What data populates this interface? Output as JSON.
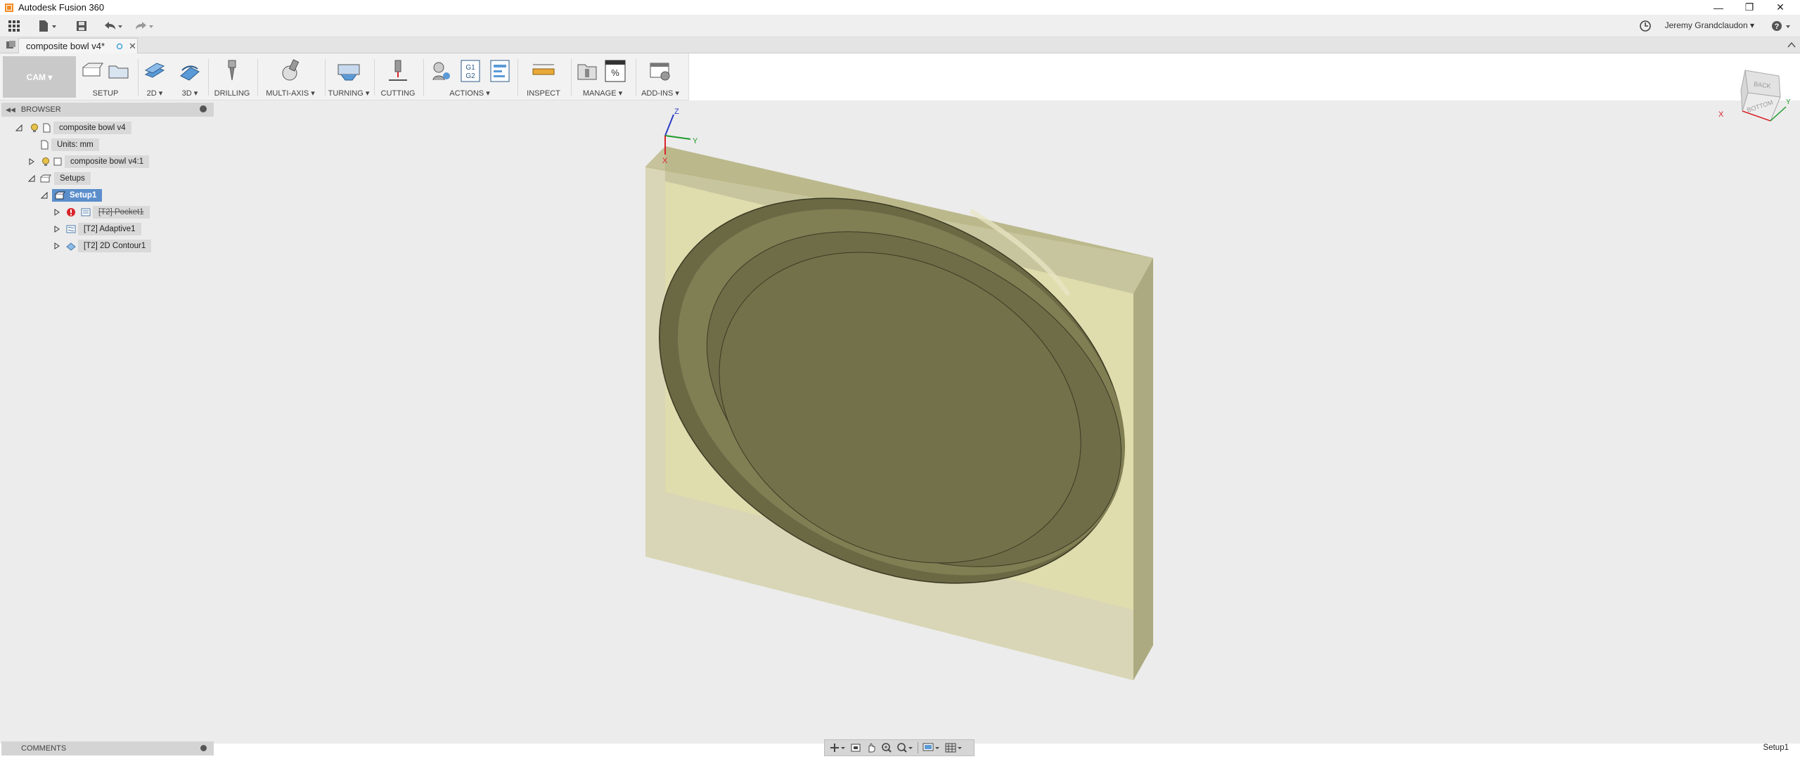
{
  "window": {
    "title": "Autodesk Fusion 360",
    "controls": [
      "minimize-icon",
      "restore-icon",
      "close-icon"
    ]
  },
  "quick_access": {
    "icons": [
      "apps-grid-icon",
      "file-icon",
      "save-icon",
      "undo-icon",
      "redo-icon"
    ],
    "job_status_icon": "clock-icon",
    "user_name": "Jeremy Grandclaudon",
    "help_icon": "help-icon"
  },
  "document_tab": {
    "name": "composite bowl v4*"
  },
  "toolbar": {
    "workspace": "CAM",
    "groups": [
      {
        "label": "SETUP"
      },
      {
        "label": "2D"
      },
      {
        "label": "3D"
      },
      {
        "label": "DRILLING"
      },
      {
        "label": "MULTI-AXIS"
      },
      {
        "label": "TURNING"
      },
      {
        "label": "CUTTING"
      },
      {
        "label": "ACTIONS"
      },
      {
        "label": "INSPECT"
      },
      {
        "label": "MANAGE"
      },
      {
        "label": "ADD-INS"
      }
    ]
  },
  "browser": {
    "title": "BROWSER",
    "tree": {
      "root": "composite bowl v4",
      "units": "Units: mm",
      "component": "composite bowl v4:1",
      "setups": "Setups",
      "setup1": "Setup1",
      "ops": [
        {
          "label": "[T2] Pocket1",
          "status": "error"
        },
        {
          "label": "[T2] Adaptive1",
          "status": "ok"
        },
        {
          "label": "[T2] 2D Contour1",
          "status": "ok"
        }
      ]
    }
  },
  "comments": {
    "title": "COMMENTS"
  },
  "viewcube": {
    "faces": [
      "BACK",
      "BOTTOM"
    ],
    "axis_x": "X",
    "axis_y": "Y",
    "axis_z": "Z"
  },
  "colors": {
    "stock": "#c9c58a",
    "part": "#6e6c48",
    "viewport_bg": "#ececec",
    "selection": "#5b8ecb",
    "error": "#d9252a"
  },
  "status_bar": {
    "active": "Setup1"
  }
}
